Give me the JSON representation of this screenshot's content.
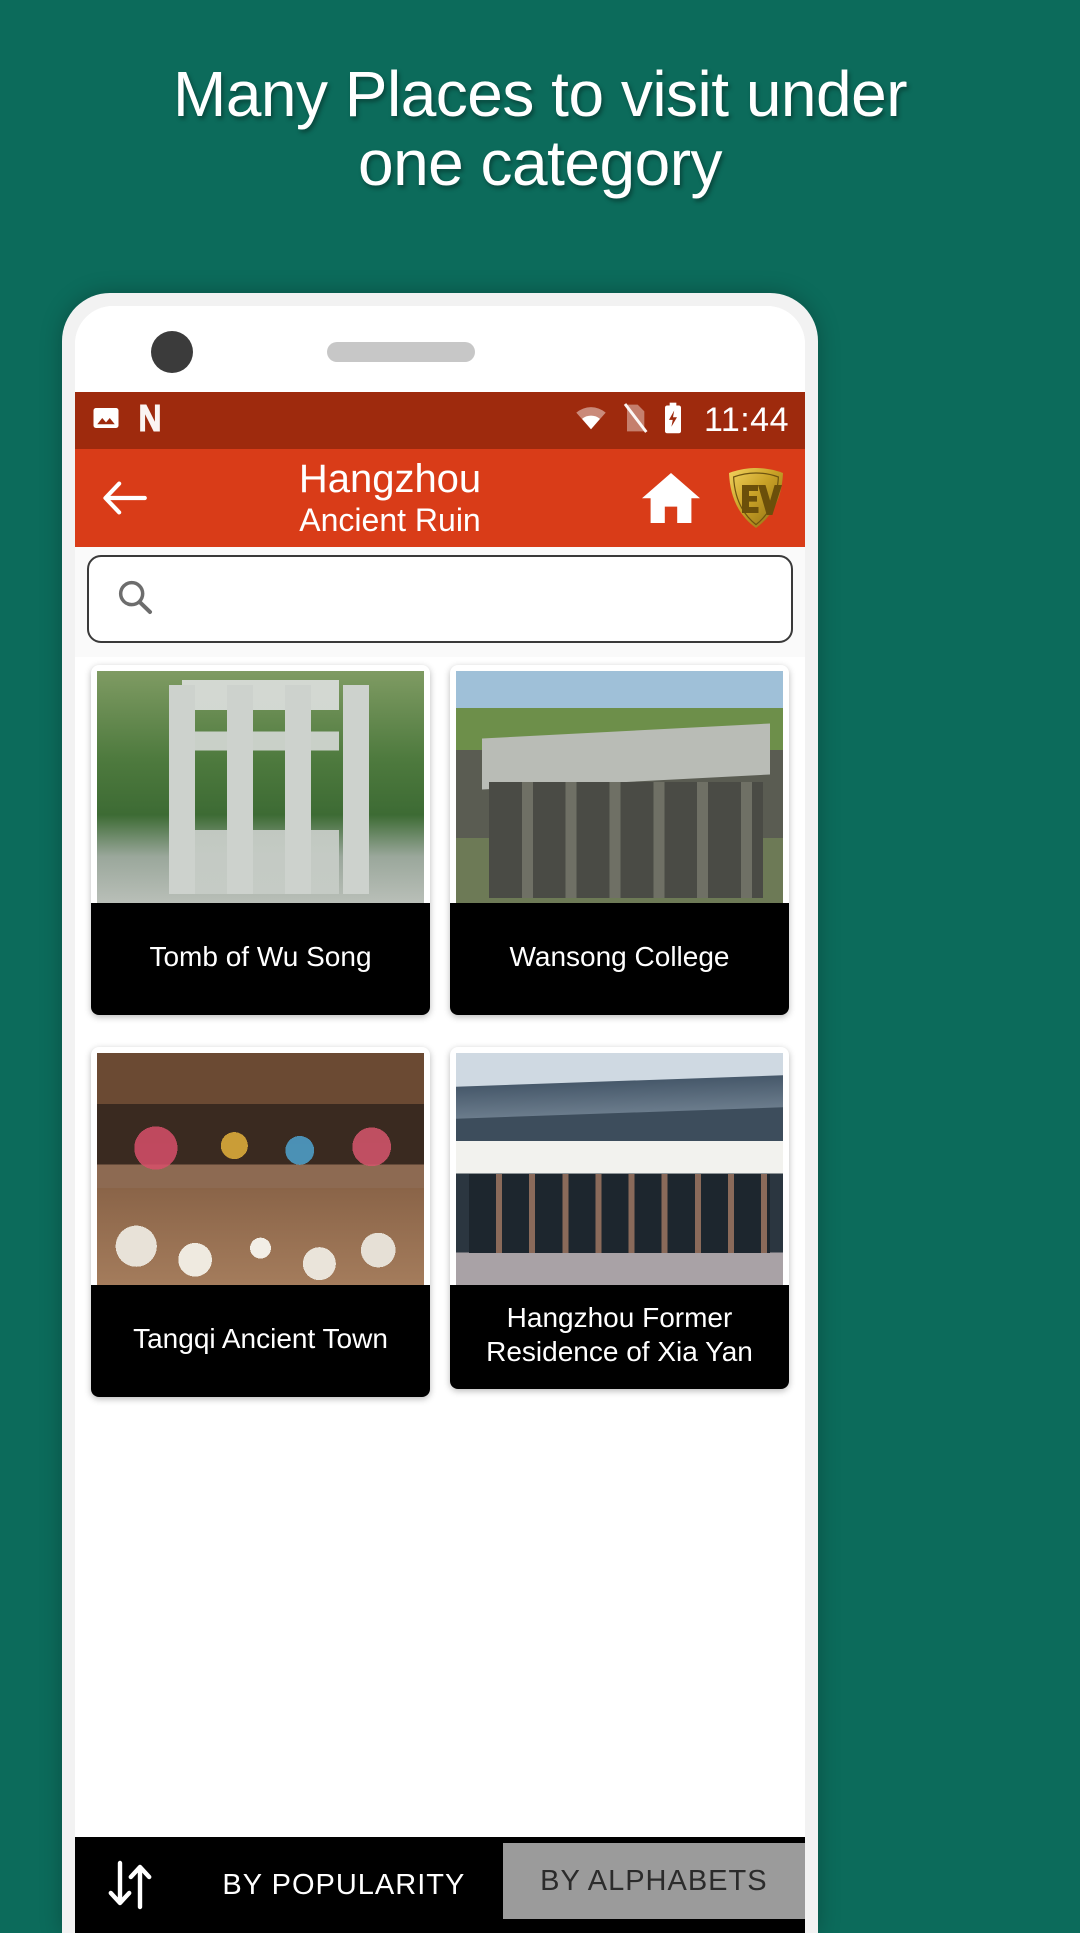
{
  "promo": {
    "line1": "Many Places to visit under",
    "line2": "one category"
  },
  "colors": {
    "background": "#0c6b5b",
    "statusbar": "#9e2a0d",
    "appbar": "#d93c18",
    "card_label": "#000000",
    "tab_active": "#000000",
    "tab_inactive": "#9b9b9b",
    "ev_logo_gold": "#c9a227"
  },
  "statusbar": {
    "time": "11:44",
    "icons_left": [
      "image-icon",
      "nova-launcher-icon"
    ],
    "icons_right": [
      "wifi-icon",
      "no-sim-icon",
      "battery-charging-icon"
    ]
  },
  "appbar": {
    "back_icon": "arrow-left-icon",
    "title": "Hangzhou",
    "subtitle": "Ancient Ruin",
    "home_icon": "home-icon",
    "logo": "ev-shield-logo"
  },
  "search": {
    "icon": "search-icon",
    "value": "",
    "placeholder": ""
  },
  "cards": [
    {
      "label": "Tomb of Wu Song",
      "photo": "photo-tomb",
      "lines": 1
    },
    {
      "label": "Wansong College",
      "photo": "photo-wansong",
      "lines": 1
    },
    {
      "label": "Tangqi Ancient Town",
      "photo": "photo-tangqi",
      "lines": 1
    },
    {
      "label": "Hangzhou Former Residence of Xia Yan",
      "photo": "photo-xiayan",
      "lines": 2
    }
  ],
  "sortbar": {
    "icon": "sort-arrows-icon",
    "tabs": [
      {
        "label": "BY POPULARITY",
        "active": true
      },
      {
        "label": "BY ALPHABETS",
        "active": false
      }
    ]
  }
}
